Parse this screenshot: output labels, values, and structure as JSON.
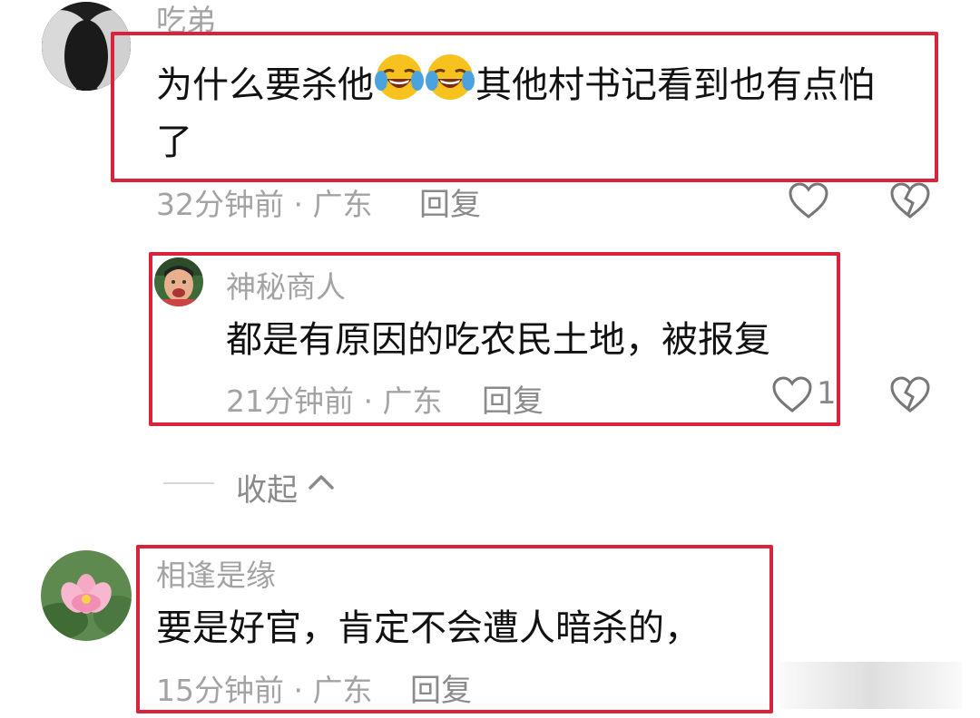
{
  "colors": {
    "highlight_box": "#d8233a",
    "muted_text": "#a3a3a3",
    "body_text": "#111111"
  },
  "comments": [
    {
      "username": "吃弟",
      "text_before": "为什么要杀他",
      "emoji": [
        "face-with-tears-of-joy",
        "face-with-tears-of-joy"
      ],
      "text_after_line1": "其他村书记看到也有点怕",
      "text_line2": "了",
      "time_location": "32分钟前 · 广东",
      "reply_label": "回复"
    },
    {
      "username": "神秘商人",
      "text": "都是有原因的吃农民土地，被报复",
      "time_location": "21分钟前 · 广东",
      "reply_label": "回复",
      "like_count": "1"
    },
    {
      "username": "相逢是缘",
      "text": "要是好官，肯定不会遭人暗杀的，",
      "time_location": "15分钟前 · 广东",
      "reply_label": "回复"
    }
  ],
  "collapse": {
    "label": "收起",
    "icon": "chevron-up-icon"
  }
}
